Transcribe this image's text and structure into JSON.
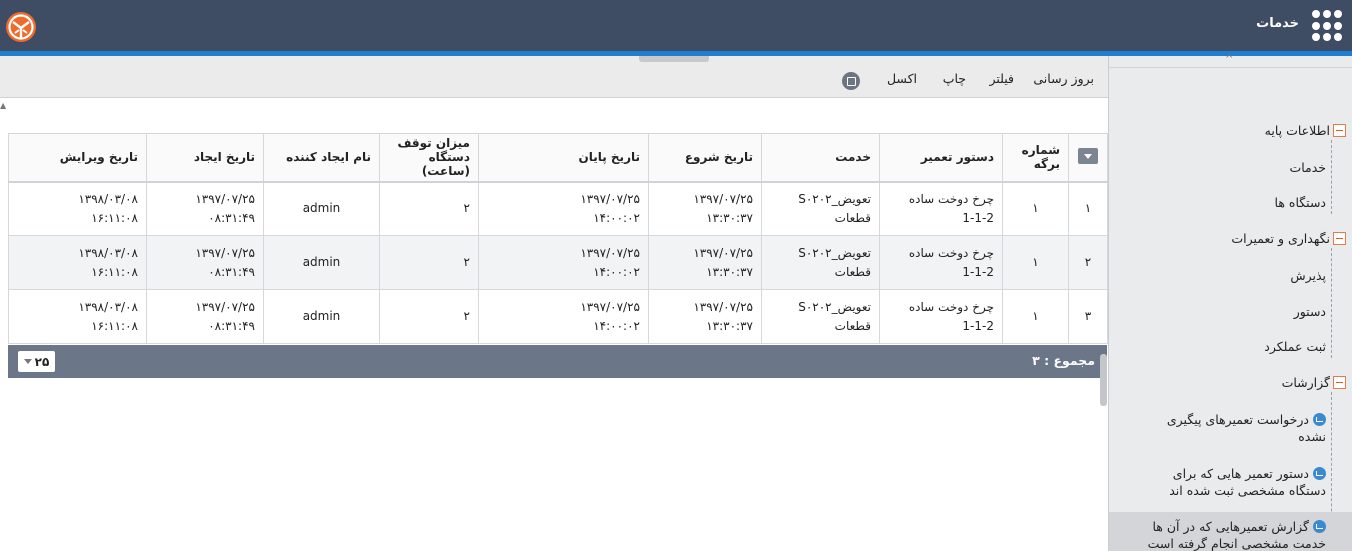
{
  "header": {
    "title": "خدمات"
  },
  "toolbar": {
    "refresh": "بروز رسانی",
    "filter": "فیلتر",
    "print": "چاپ",
    "excel": "اکسل"
  },
  "sidebar": {
    "groups": [
      {
        "label": "اطلاعات پایه",
        "items": [
          "خدمات",
          "دستگاه ها"
        ]
      },
      {
        "label": "نگهداری و تعمیرات",
        "items": [
          "پذیرش",
          "دستور",
          "ثبت عملکرد"
        ]
      },
      {
        "label": "گزارشات",
        "items": [
          "درخواست تعمیرهای پیگیری نشده",
          "دستور تعمیر هایی که برای دستگاه مشخصی ثبت شده اند",
          "گزارش تعمیرهایی که در آن ها خدمت مشخصی انجام گرفته است"
        ]
      }
    ]
  },
  "table": {
    "columns": [
      "شماره برگه",
      "دستور تعمیر",
      "خدمت",
      "تاریخ شروع",
      "تاریخ پایان",
      "میزان توقف دستگاه (ساعت)",
      "نام ایجاد کننده",
      "تاریخ ایجاد",
      "تاریخ ویرایش"
    ],
    "rows": [
      {
        "rownum": "۱",
        "sheet": "۱",
        "order_l1": "چرخ دوخت ساده",
        "order_l2": "1-1-2",
        "service_l1": "تعویض_S۰۲۰۲",
        "service_l2": "قطعات",
        "start_date": "۱۳۹۷/۰۷/۲۵",
        "start_time": "۱۳:۳۰:۳۷",
        "end_date": "۱۳۹۷/۰۷/۲۵",
        "end_time": "۱۴:۰۰:۰۲",
        "downtime": "۲",
        "creator": "admin",
        "created_date": "۱۳۹۷/۰۷/۲۵",
        "created_time": "۰۸:۳۱:۴۹",
        "edited_date": "۱۳۹۸/۰۳/۰۸",
        "edited_time": "۱۶:۱۱:۰۸"
      },
      {
        "rownum": "۲",
        "sheet": "۱",
        "order_l1": "چرخ دوخت ساده",
        "order_l2": "1-1-2",
        "service_l1": "تعویض_S۰۲۰۲",
        "service_l2": "قطعات",
        "start_date": "۱۳۹۷/۰۷/۲۵",
        "start_time": "۱۳:۳۰:۳۷",
        "end_date": "۱۳۹۷/۰۷/۲۵",
        "end_time": "۱۴:۰۰:۰۲",
        "downtime": "۲",
        "creator": "admin",
        "created_date": "۱۳۹۷/۰۷/۲۵",
        "created_time": "۰۸:۳۱:۴۹",
        "edited_date": "۱۳۹۸/۰۳/۰۸",
        "edited_time": "۱۶:۱۱:۰۸"
      },
      {
        "rownum": "۳",
        "sheet": "۱",
        "order_l1": "چرخ دوخت ساده",
        "order_l2": "1-1-2",
        "service_l1": "تعویض_S۰۲۰۲",
        "service_l2": "قطعات",
        "start_date": "۱۳۹۷/۰۷/۲۵",
        "start_time": "۱۳:۳۰:۳۷",
        "end_date": "۱۳۹۷/۰۷/۲۵",
        "end_time": "۱۴:۰۰:۰۲",
        "downtime": "۲",
        "creator": "admin",
        "created_date": "۱۳۹۷/۰۷/۲۵",
        "created_time": "۰۸:۳۱:۴۹",
        "edited_date": "۱۳۹۸/۰۳/۰۸",
        "edited_time": "۱۶:۱۱:۰۸"
      }
    ]
  },
  "footer": {
    "total_label": "مجموع :",
    "total_value": "۳",
    "page_size": "۲۵"
  },
  "icons": {
    "apps": "grid-dots-icon",
    "logo": "brand-logo-icon",
    "column_menu": "chevron-down-icon",
    "excel": "export-icon",
    "tree_toggle": "minus-box-icon",
    "report": "chart-icon"
  },
  "colors": {
    "header_bg": "#3f4d64",
    "header_accent": "#1e7fd1",
    "footer_bg": "#6b7789",
    "tree_toggle": "#e05a1f",
    "report_icon": "#3b8ad0"
  }
}
